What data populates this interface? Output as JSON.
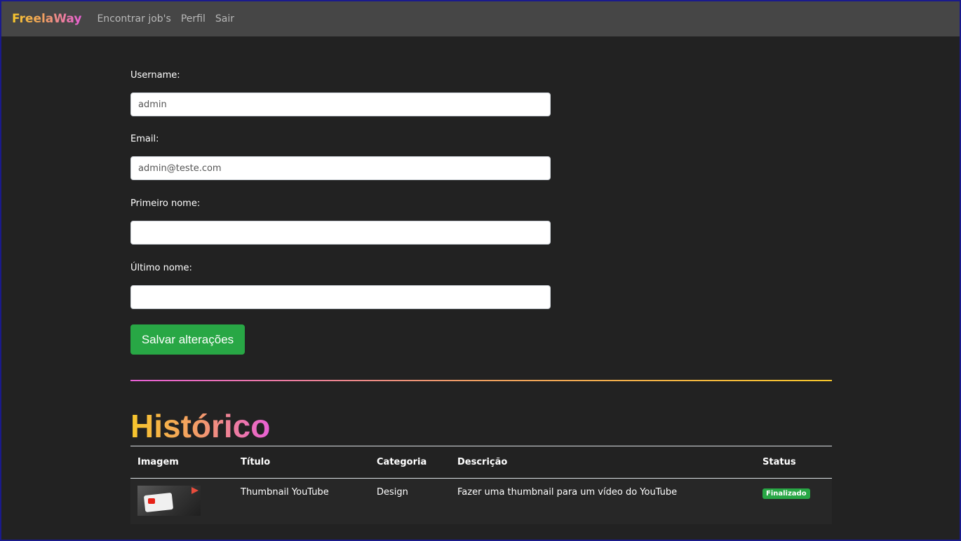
{
  "navbar": {
    "brand": "FreelaWay",
    "links": [
      "Encontrar job's",
      "Perfil",
      "Sair"
    ]
  },
  "form": {
    "username_label": "Username:",
    "username_value": "admin",
    "email_label": "Email:",
    "email_value": "admin@teste.com",
    "first_name_label": "Primeiro nome:",
    "first_name_value": "",
    "last_name_label": "Último nome:",
    "last_name_value": "",
    "save_label": "Salvar alterações"
  },
  "history": {
    "title": "Histórico",
    "columns": [
      "Imagem",
      "Título",
      "Categoria",
      "Descrição",
      "Status"
    ],
    "rows": [
      {
        "image": "youtube-thumbnail-image",
        "title": "Thumbnail YouTube",
        "category": "Design",
        "description": "Fazer uma thumbnail para um vídeo do YouTube",
        "status": "Finalizado"
      }
    ]
  },
  "colors": {
    "background": "#222222",
    "navbar": "#464646",
    "success": "#28a745",
    "gradient_yellow": "#f7c72b",
    "gradient_pink": "#e85fd6"
  }
}
